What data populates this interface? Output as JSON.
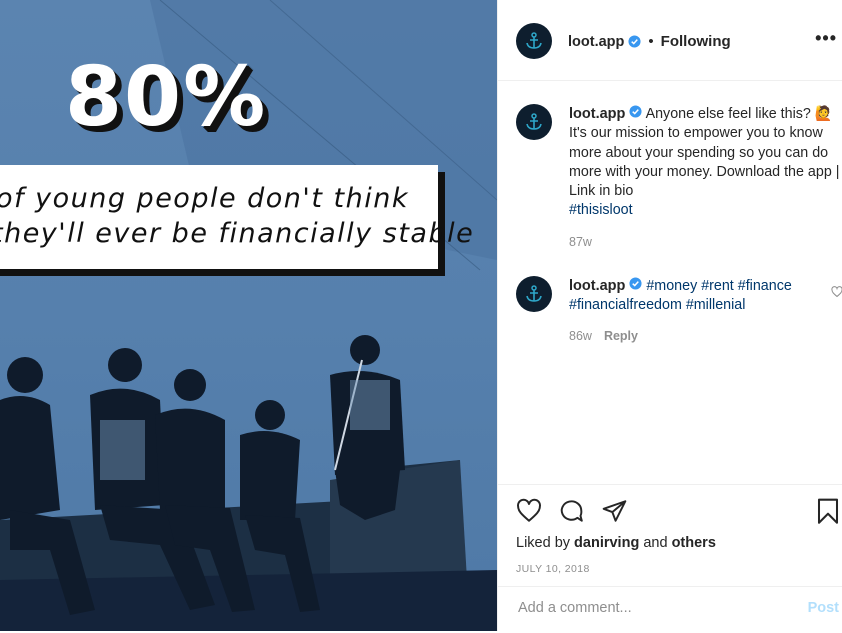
{
  "image": {
    "big_text": "80%",
    "caption_line1": "of young people don't think",
    "caption_line2": "they'll ever be financially stable"
  },
  "header": {
    "username": "loot.app",
    "dot": "•",
    "follow_status": "Following",
    "more": "•••"
  },
  "comments": [
    {
      "username": "loot.app",
      "text": "Anyone else feel like this? 🙋 It's our mission to empower you to know more about your spending so you can do more with your money. Download the app | Link in bio",
      "hashtags": "#thisisloot",
      "time": "87w"
    },
    {
      "username": "loot.app",
      "hashtags_line1": "#money #rent #finance",
      "hashtags_line2": "#financialfreedom #millenial",
      "time": "86w",
      "reply": "Reply"
    }
  ],
  "actions": {
    "liked_prefix": "Liked by",
    "liked_user": "danirving",
    "liked_and": "and",
    "liked_others": "others",
    "date": "JULY 10, 2018",
    "comment_placeholder": "Add a comment...",
    "post_label": "Post"
  },
  "colors": {
    "image_blue": "#5a85b2",
    "verified_blue": "#3897f0",
    "hashtag": "#00376b",
    "post_disabled": "#b2dffc"
  }
}
